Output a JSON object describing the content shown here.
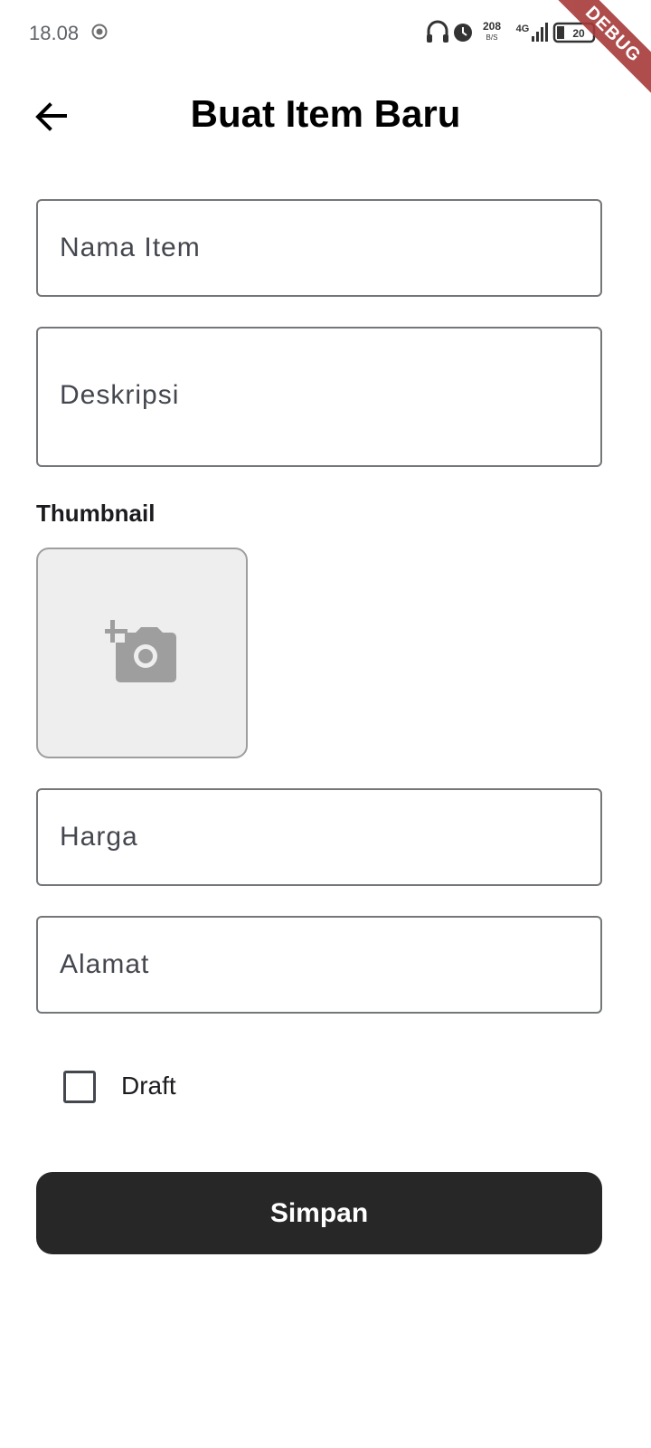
{
  "status_bar": {
    "time": "18.08",
    "net_speed_value": "208",
    "net_speed_unit": "B/S",
    "network": "4G",
    "battery": "20"
  },
  "debug_banner": "DEBUG",
  "app_bar": {
    "title": "Buat Item Baru",
    "back_icon": "arrow-back-icon"
  },
  "form": {
    "name_placeholder": "Nama Item",
    "description_placeholder": "Deskripsi",
    "thumbnail_label": "Thumbnail",
    "thumbnail_icon": "add-photo-icon",
    "price_placeholder": "Harga",
    "address_placeholder": "Alamat",
    "draft_label": "Draft",
    "draft_checked": false,
    "save_label": "Simpan"
  }
}
